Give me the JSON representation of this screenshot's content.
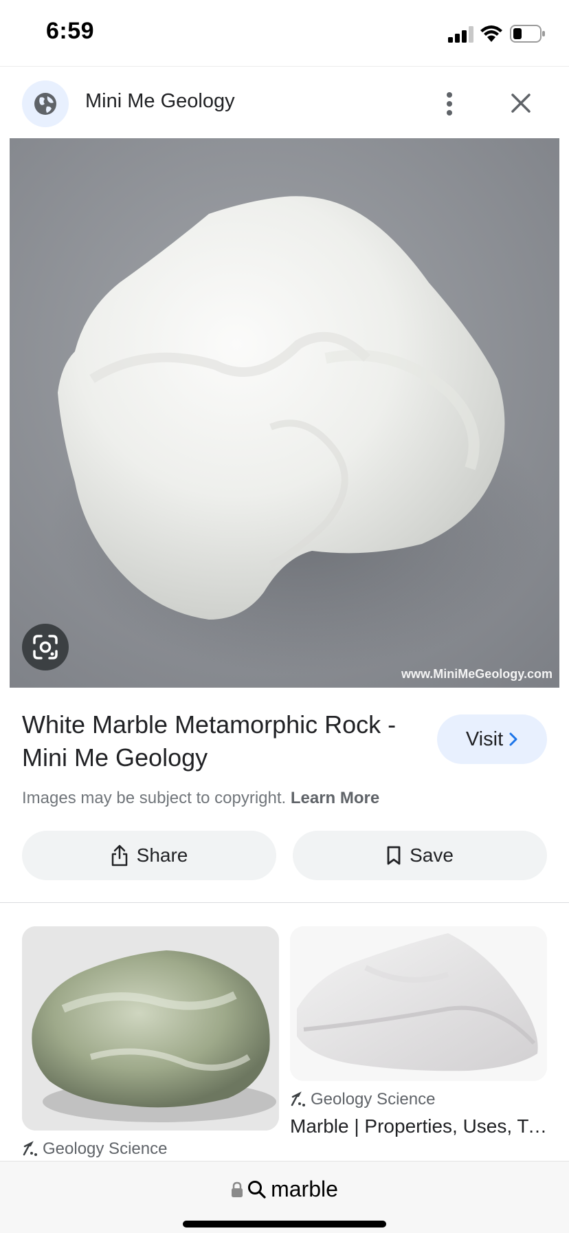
{
  "status_bar": {
    "time": "6:59"
  },
  "header": {
    "site_name": "Mini Me Geology"
  },
  "main_image": {
    "watermark": "www.MiniMeGeology.com"
  },
  "result": {
    "title": "White Marble Metamorphic Rock - Mini Me Geology",
    "visit_label": "Visit",
    "copyright_text": "Images may be subject to copyright.",
    "learn_more": "Learn More",
    "share_label": "Share",
    "save_label": "Save"
  },
  "related": [
    {
      "source": "Geology Science",
      "title": ""
    },
    {
      "source": "Geology Science",
      "title": "Marble | Properties, Uses, Types & Facts"
    }
  ],
  "address_bar": {
    "query": "marble"
  },
  "colors": {
    "accent_bg": "#e8f0fe",
    "button_bg": "#f1f3f4",
    "image_bg": "#8a8d92"
  },
  "icons": [
    "globe-icon",
    "more-vert-icon",
    "close-icon",
    "google-lens-icon",
    "chevron-right-icon",
    "share-icon",
    "bookmark-icon",
    "source-logo-icon",
    "lock-icon",
    "search-icon"
  ]
}
